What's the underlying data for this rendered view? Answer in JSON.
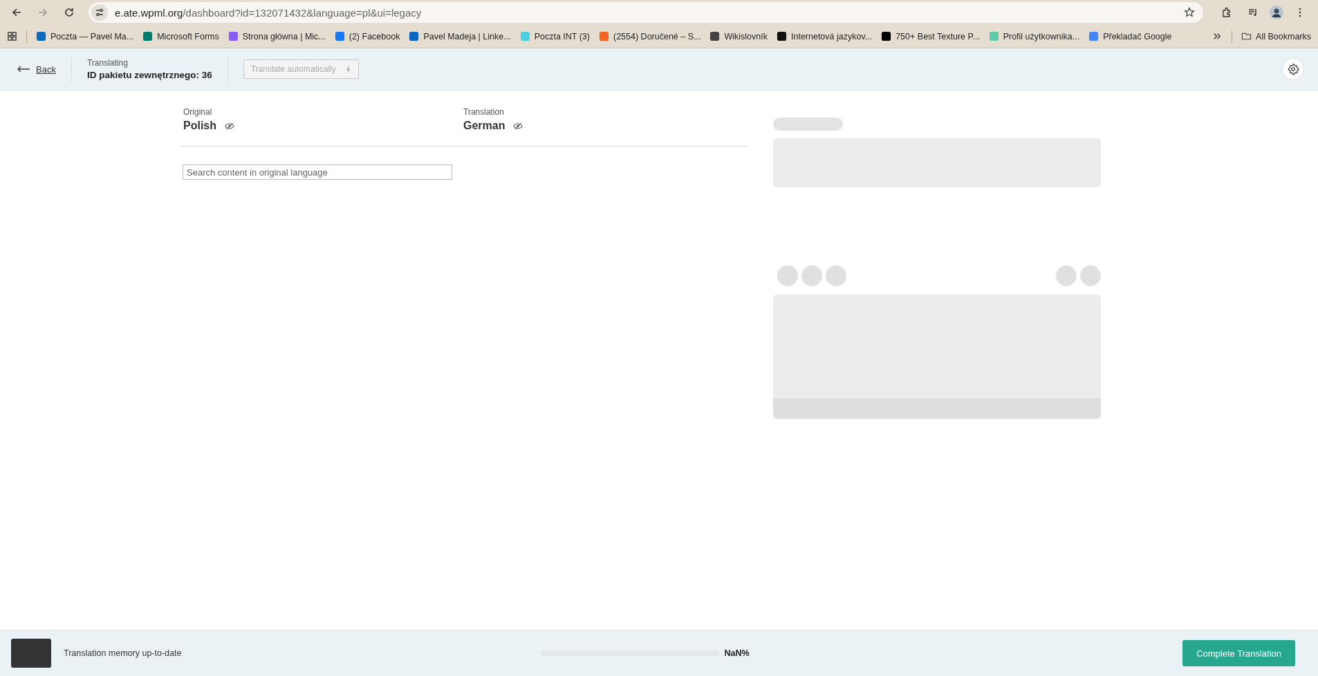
{
  "browser": {
    "url_host": "e.ate.wpml.org",
    "url_path": "/dashboard?id=132071432&language=pl&ui=legacy",
    "bookmarks": [
      {
        "label": "Poczta — Pavel Ma...",
        "color": "#0f6cbd"
      },
      {
        "label": "Microsoft Forms",
        "color": "#037c6e"
      },
      {
        "label": "Strona główna | Mic...",
        "color": "#8a5cf6"
      },
      {
        "label": "(2) Facebook",
        "color": "#1877f2"
      },
      {
        "label": "Pavel Madeja | Linke...",
        "color": "#0a66c2"
      },
      {
        "label": "Poczta INT (3)",
        "color": "#4dd0e1"
      },
      {
        "label": "(2554) Doručené – S...",
        "color": "#f26522"
      },
      {
        "label": "Wikislovník",
        "color": "#444444"
      },
      {
        "label": "Internetová jazykov...",
        "color": "#111111"
      },
      {
        "label": "750+ Best Texture P...",
        "color": "#000000"
      },
      {
        "label": "Profil użytkownika...",
        "color": "#5fc9a8"
      },
      {
        "label": "Překladač Google",
        "color": "#4285f4"
      }
    ],
    "all_bookmarks": "All Bookmarks"
  },
  "header": {
    "back": "Back",
    "subtitle": "Translating",
    "title": "ID pakietu zewnętrznego: 36",
    "auto_translate": {
      "label": "Translate automatically",
      "disabled": true
    }
  },
  "columns": [
    {
      "caption": "Original",
      "language": "Polish"
    },
    {
      "caption": "Translation",
      "language": "German"
    }
  ],
  "search": {
    "placeholder": "Search content in original language"
  },
  "footer": {
    "status": "Translation memory up-to-date",
    "reading": "NaN%",
    "complete": "Complete Translation"
  }
}
